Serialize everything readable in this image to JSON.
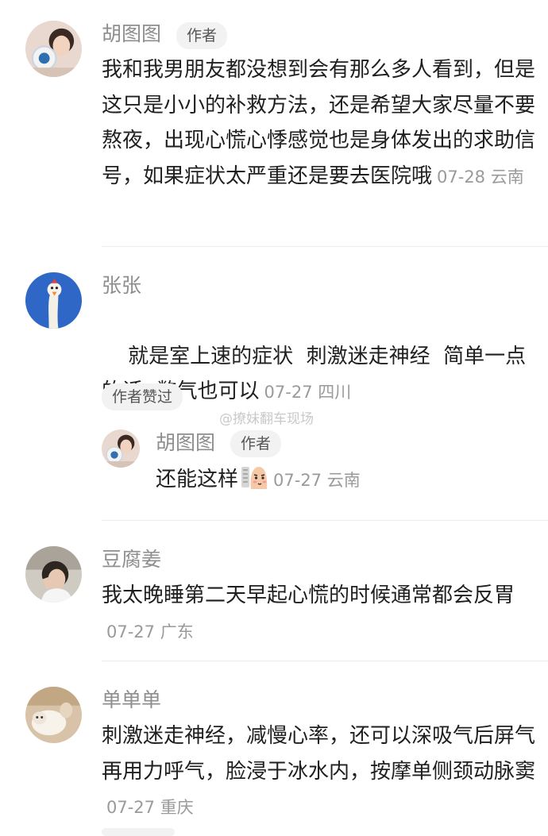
{
  "author_badge": "作者",
  "liked_badge": "作者赞过",
  "watermark": "@撩妹翻车现场",
  "comments": [
    {
      "user": "胡图图",
      "text": "我和我男朋友都没想到会有那么多人看到，但是这只是小小的补救方法，还是希望大家尽量不要熬夜，出现心慌心悸感觉也是身体发出的求助信号，如果症状太严重还是要去医院哦",
      "date": "07-28",
      "location": "云南"
    },
    {
      "user": "张张",
      "text": "就是室上速的症状  刺激迷走神经  简单一点的话  憋气也可以",
      "date": "07-27",
      "location": "四川",
      "reply": {
        "user": "胡图图",
        "text": "还能这样",
        "date": "07-27",
        "location": "云南"
      }
    },
    {
      "user": "豆腐姜",
      "text": "我太晚睡第二天早起心慌的时候通常都会反胃",
      "date": "07-27",
      "location": "广东"
    },
    {
      "user": "单单单",
      "text": "刺激迷走神经，减慢心率，还可以深吸气后屏气再用力呼气，脸浸于冰水内，按摩单侧颈动脉窦",
      "date": "07-27",
      "location": "重庆"
    }
  ]
}
